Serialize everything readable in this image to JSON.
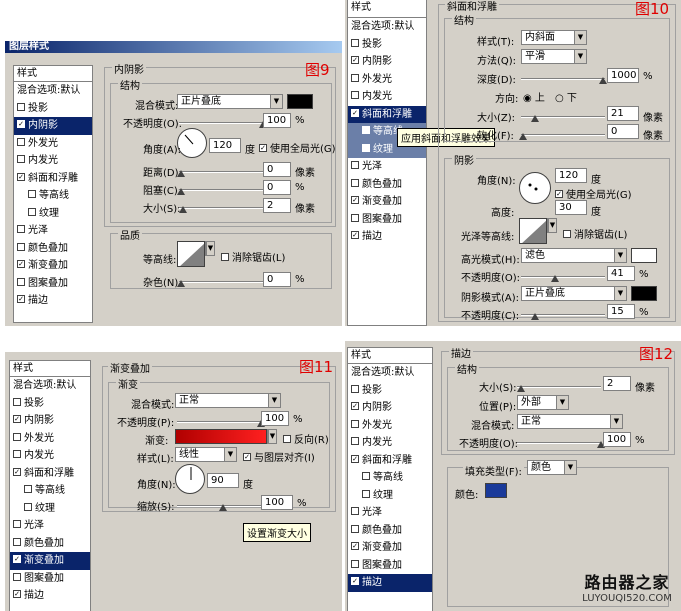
{
  "style_list_items": {
    "head": "样式",
    "blend": "混合选项:默认",
    "drop_shadow": "投影",
    "inner_shadow": "内阴影",
    "outer_glow": "外发光",
    "inner_glow": "内发光",
    "bevel": "斜面和浮雕",
    "contour": "等高线",
    "texture": "纹理",
    "satin": "光泽",
    "color_overlay": "颜色叠加",
    "gradient_overlay": "渐变叠加",
    "pattern_overlay": "图案叠加",
    "stroke": "描边"
  },
  "common": {
    "percent": "%",
    "degree": "度",
    "pixel": "像素"
  },
  "p9": {
    "window_title": "图层样式",
    "fig": "图9",
    "section": "内阴影",
    "structure": "结构",
    "blend_mode_label": "混合模式:",
    "blend_mode": "正片叠底",
    "opacity_label": "不透明度(O):",
    "opacity": "100",
    "angle_label": "角度(A):",
    "angle": "120",
    "global_light": "使用全局光(G)",
    "distance_label": "距离(D):",
    "distance": "0",
    "choke_label": "阻塞(C):",
    "choke": "0",
    "size_label": "大小(S):",
    "size": "2",
    "quality": "品质",
    "contour_label": "等高线:",
    "antialias": "消除锯齿(L)",
    "noise_label": "杂色(N):",
    "noise": "0",
    "shadow_color": "#000000"
  },
  "p10": {
    "fig": "图10",
    "section": "斜面和浮雕",
    "structure": "结构",
    "style_label": "样式(T):",
    "style": "内斜面",
    "technique_label": "方法(Q):",
    "technique": "平滑",
    "depth_label": "深度(D):",
    "depth": "1000",
    "direction_label": "方向:",
    "up": "上",
    "down": "下",
    "size_label": "大小(Z):",
    "size": "21",
    "soften_label": "软化(F):",
    "soften": "0",
    "shading": "阴影",
    "angle_label": "角度(N):",
    "angle": "120",
    "global_light": "使用全局光(G)",
    "altitude_label": "高度:",
    "altitude": "30",
    "gloss_label": "光泽等高线:",
    "antialias": "消除锯齿(L)",
    "highlight_mode_label": "高光模式(H):",
    "highlight_mode": "滤色",
    "highlight_opacity_label": "不透明度(O):",
    "highlight_opacity": "41",
    "shadow_mode_label": "阴影模式(A):",
    "shadow_mode": "正片叠底",
    "shadow_opacity_label": "不透明度(C):",
    "shadow_opacity": "15",
    "tooltip": "应用斜面和浮雕效果",
    "highlight_color": "#ffffff",
    "shadow_color": "#000000"
  },
  "p11": {
    "fig": "图11",
    "section": "渐变叠加",
    "gradient_group": "渐变",
    "blend_mode_label": "混合模式:",
    "blend_mode": "正常",
    "opacity_label": "不透明度(P):",
    "opacity": "100",
    "gradient_label": "渐变:",
    "reverse": "反向(R)",
    "style_label": "样式(L):",
    "style": "线性",
    "align": "与图层对齐(I)",
    "angle_label": "角度(N):",
    "angle": "90",
    "scale_label": "缩放(S):",
    "scale": "100",
    "tooltip": "设置渐变大小",
    "gradient_start": "#b00000",
    "gradient_end": "#ff2020"
  },
  "p12": {
    "fig": "图12",
    "section": "描边",
    "structure": "结构",
    "size_label": "大小(S):",
    "size": "2",
    "position_label": "位置(P):",
    "position": "外部",
    "blend_mode_label": "混合模式:",
    "blend_mode": "正常",
    "opacity_label": "不透明度(O):",
    "opacity": "100",
    "fill_type_label": "填充类型(F):",
    "fill_type": "颜色",
    "color_label": "颜色:",
    "stroke_color": "#1a3a9a"
  },
  "watermark": {
    "title": "路由器之家",
    "url": "LUYOUQI520.COM"
  }
}
